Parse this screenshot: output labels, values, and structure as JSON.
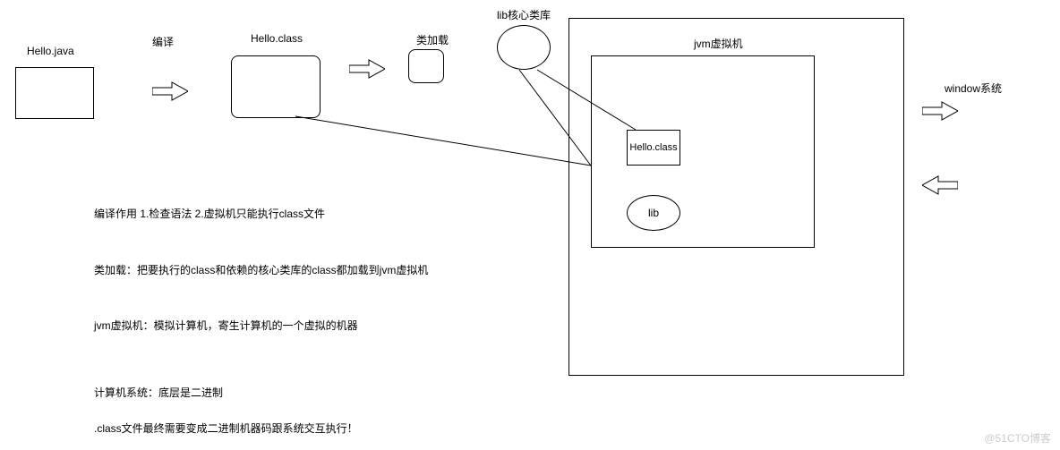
{
  "labels": {
    "hello_java": "Hello.java",
    "compile": "编译",
    "hello_class": "Hello.class",
    "class_loading": "类加载",
    "lib_core": "lib核心类库",
    "jvm": "jvm虚拟机",
    "window_sys": "window系统",
    "inner_hello_class": "Hello.class",
    "inner_lib": "lib"
  },
  "notes": {
    "n1": "编译作用    1.检查语法    2.虚拟机只能执行class文件",
    "n2": "类加载：把要执行的class和依赖的核心类库的class都加载到jvm虚拟机",
    "n3": "jvm虚拟机：模拟计算机，寄生计算机的一个虚拟的机器",
    "n4": "计算机系统：底层是二进制",
    "n5": ".class文件最终需要变成二进制机器码跟系统交互执行！"
  },
  "watermark": "@51CTO博客"
}
